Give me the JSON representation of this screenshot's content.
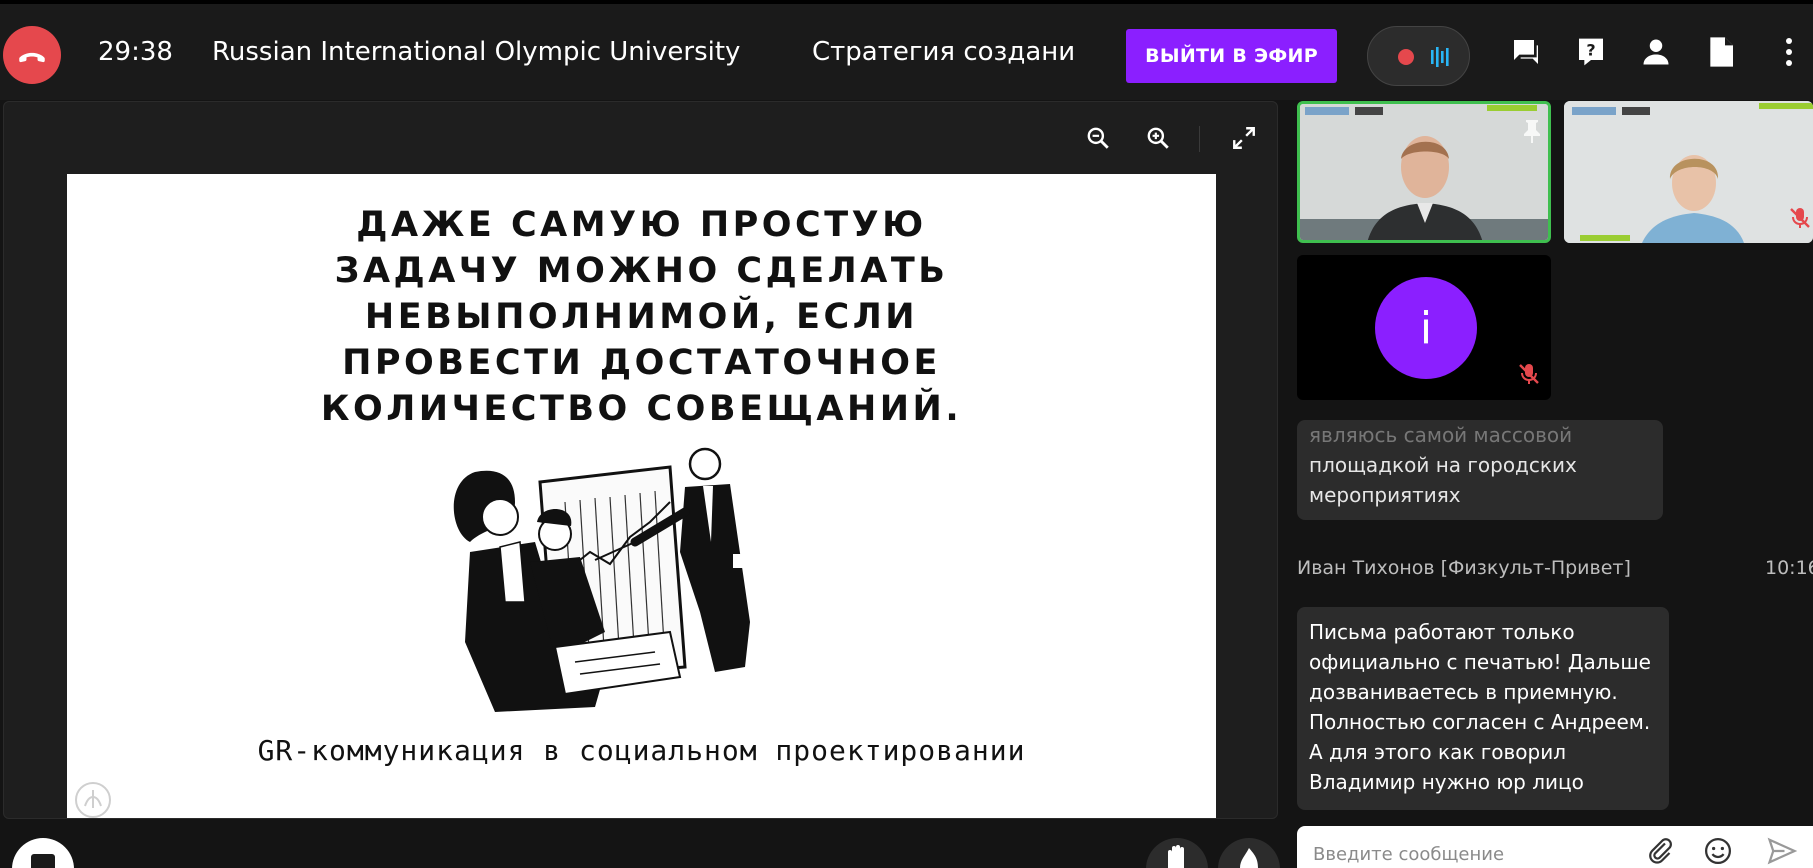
{
  "header": {
    "timer": "29:38",
    "conference_title": "Russian International Olympic University",
    "topic": "Стратегия создани",
    "go_live_label": "ВЫЙТИ В ЭФИР"
  },
  "slide": {
    "headline": "ДАЖЕ САМУЮ ПРОСТУЮ\nЗАДАЧУ МОЖНО СДЕЛАТЬ\nНЕВЫПОЛНИМОЙ, ЕСЛИ\nПРОВЕСТИ ДОСТАТОЧНОЕ\nКОЛИЧЕСТВО СОВЕЩАНИЙ.",
    "caption": "GR-коммуникация в социальном проектировании"
  },
  "participants": {
    "third_avatar_letter": "i"
  },
  "chat": {
    "message_1_lines": [
      "являюсь самой массовой",
      "площадкой на городских",
      "мероприятиях"
    ],
    "message_2": {
      "author": "Иван Тихонов [Физкульт-Привет]",
      "time": "10:16",
      "lines": [
        "Письма работают только",
        "официально с печатью! Дальше",
        "дозваниваетесь в приемную.",
        "Полностью согласен с Андреем.",
        "А для этого как говорил",
        "Владимир нужно юр лицо"
      ]
    },
    "input_placeholder": "Введите сообщение"
  },
  "colors": {
    "accent_purple": "#8b1fff",
    "hangup_red": "#e5484d",
    "active_speaker_green": "#3fbf4f"
  },
  "icons": {
    "hangup": "phone-hangup-icon",
    "record": "record-dot-icon",
    "audio_levels": "audio-levels-icon",
    "chat": "chat-icon",
    "help": "help-icon",
    "participants": "person-icon",
    "files": "document-icon",
    "more": "more-vertical-icon",
    "zoom_out": "zoom-out-icon",
    "zoom_in": "zoom-in-icon",
    "fullscreen": "fullscreen-icon",
    "pin": "pin-icon",
    "muted": "mic-off-icon"
  }
}
